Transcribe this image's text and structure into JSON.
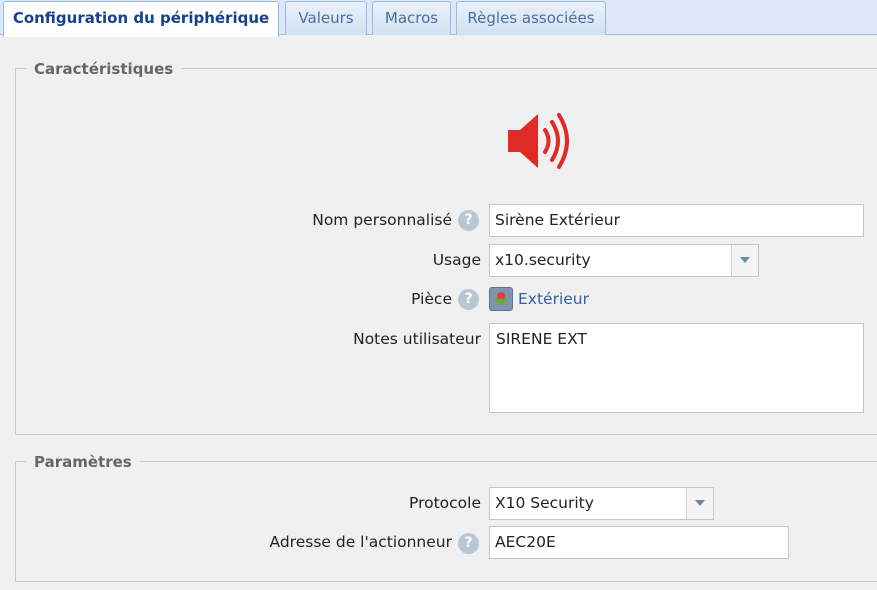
{
  "tabs": [
    {
      "label": "Configuration du périphérique"
    },
    {
      "label": "Valeurs"
    },
    {
      "label": "Macros"
    },
    {
      "label": "Règles associées"
    }
  ],
  "characteristics": {
    "legend": "Caractéristiques",
    "device_icon": "speaker-icon",
    "name_label": "Nom personnalisé",
    "name_value": "Sirène Extérieur",
    "usage_label": "Usage",
    "usage_value": "x10.security",
    "room_label": "Pièce",
    "room_icon": "room-icon",
    "room_value": "Extérieur",
    "notes_label": "Notes utilisateur",
    "notes_value": "SIRENE EXT"
  },
  "parameters": {
    "legend": "Paramètres",
    "protocol_label": "Protocole",
    "protocol_value": "X10 Security",
    "address_label": "Adresse de l'actionneur",
    "address_value": "AEC20E"
  },
  "colors": {
    "speaker": "#e02a26",
    "accent": "#15428b",
    "link": "#2f5fa7"
  }
}
